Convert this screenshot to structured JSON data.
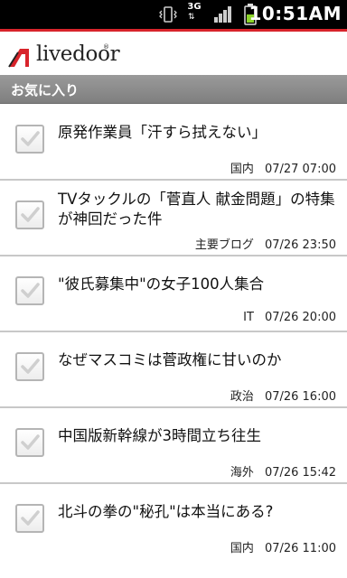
{
  "status_bar": {
    "network": "3G",
    "time": "10:51AM",
    "icons": [
      "vibrate-icon",
      "network-3g-icon",
      "signal-icon",
      "battery-icon"
    ]
  },
  "app": {
    "logo_text": "livedoor",
    "logo_mark": "TM",
    "brand_color": "#d8242b"
  },
  "section": {
    "title": "お気に入り"
  },
  "items": [
    {
      "title": "原発作業員「汗すら拭えない」",
      "category": "国内",
      "datetime": "07/27 07:00"
    },
    {
      "title": "TVタックルの「菅直人 献金問題」の特集が神回だった件",
      "category": "主要ブログ",
      "datetime": "07/26 23:50"
    },
    {
      "title": "\"彼氏募集中\"の女子100人集合",
      "category": "IT",
      "datetime": "07/26 20:00"
    },
    {
      "title": "なぜマスコミは菅政権に甘いのか",
      "category": "政治",
      "datetime": "07/26 16:00"
    },
    {
      "title": "中国版新幹線が3時間立ち往生",
      "category": "海外",
      "datetime": "07/26 15:42"
    },
    {
      "title": "北斗の拳の\"秘孔\"は本当にある?",
      "category": "国内",
      "datetime": "07/26 11:00"
    }
  ]
}
